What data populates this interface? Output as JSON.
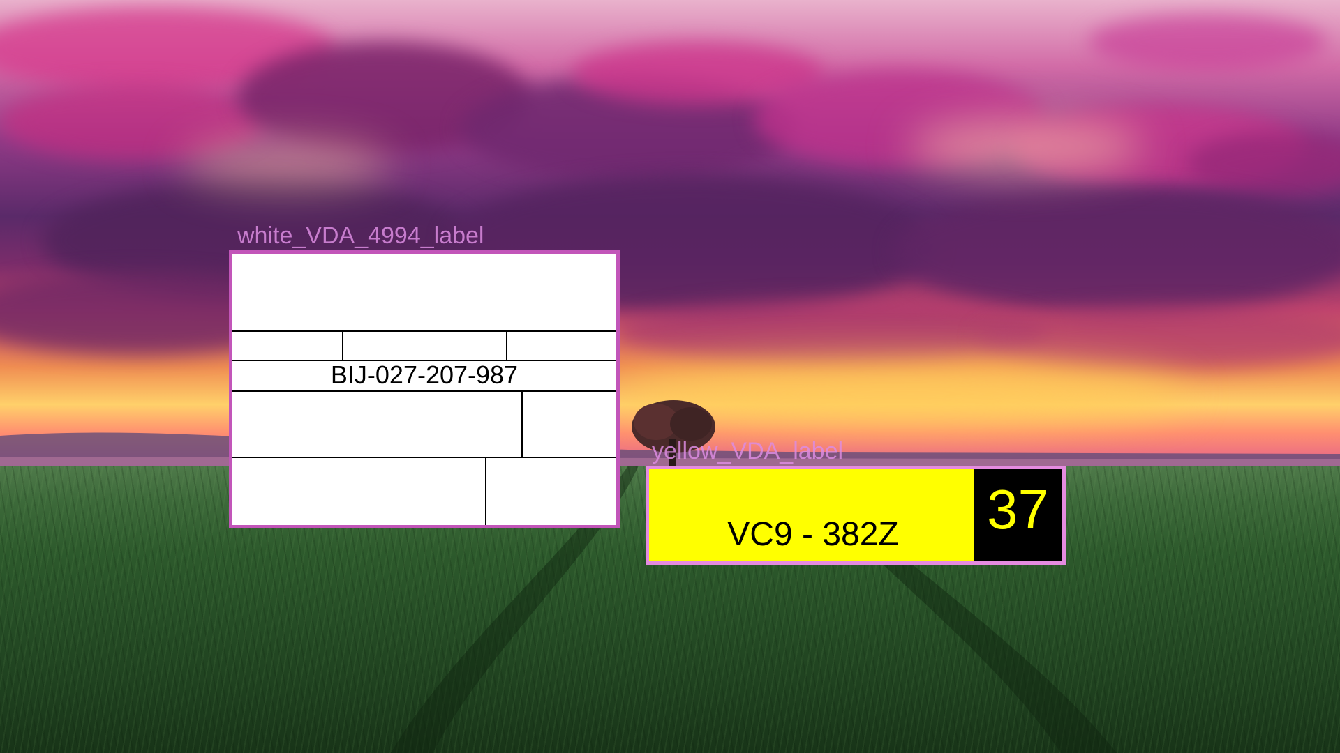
{
  "scene": {
    "description_icon": "landscape-sunset-field",
    "colors": {
      "annotation_border": "#c255b9",
      "annotation_border_yellow": "#e58be0",
      "annotation_caption": "#dc8ce1",
      "yellow_label_fill": "#ffff00",
      "yellow_label_number_fill": "#000000",
      "yellow_label_number_text": "#ffff00"
    }
  },
  "annotations": {
    "white_label": {
      "caption": "white_VDA_4994_label",
      "code": "BIJ-027-207-987"
    },
    "yellow_label": {
      "caption": "yellow_VDA_label",
      "code": "VC9 - 382Z",
      "number": "37"
    }
  }
}
